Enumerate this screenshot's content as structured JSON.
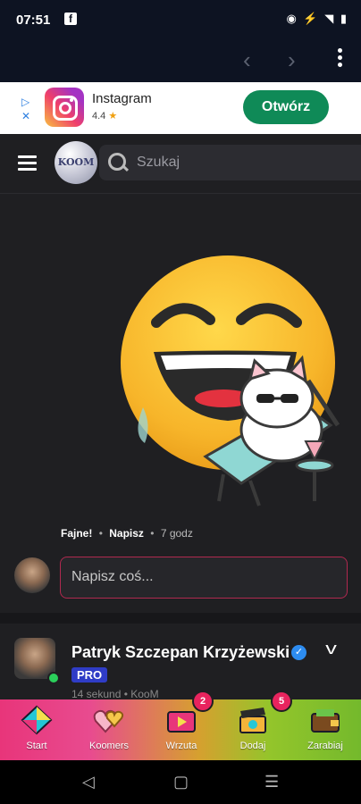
{
  "status_bar": {
    "time": "07:51",
    "app_icon": "facebook-icon",
    "right_icons": "◉ ⚡ ◥ ▮"
  },
  "browser": {
    "back_icon": "chevron-left-icon",
    "forward_icon": "chevron-right-icon",
    "menu_icon": "more-vertical-icon"
  },
  "ad": {
    "app_name": "Instagram",
    "rating": "4.4",
    "star": "★",
    "cta": "Otwórz"
  },
  "header": {
    "logo_text": "KOOM",
    "search_placeholder": "Szukaj"
  },
  "post1": {
    "like_label": "Fajne!",
    "reply_label": "Napisz",
    "separator": "•",
    "time": "7 godz",
    "comment_placeholder": "Napisz coś..."
  },
  "post2": {
    "author": "Patryk Szczepan Krzyżewski",
    "badge": "PRO",
    "meta": "14 sekund • KooM"
  },
  "bottom_nav": {
    "items": [
      {
        "label": "Start",
        "icon": "diamond-icon"
      },
      {
        "label": "Koomers",
        "icon": "hearts-icon"
      },
      {
        "label": "Wrzuta",
        "icon": "video-icon",
        "badge": "2"
      },
      {
        "label": "Dodaj",
        "icon": "clapperboard-icon",
        "badge": "5"
      },
      {
        "label": "Zarabiaj",
        "icon": "wallet-icon"
      }
    ]
  },
  "colors": {
    "accent": "#e8357a",
    "open_button": "#0f8a57",
    "pro": "#2f3cc6"
  }
}
